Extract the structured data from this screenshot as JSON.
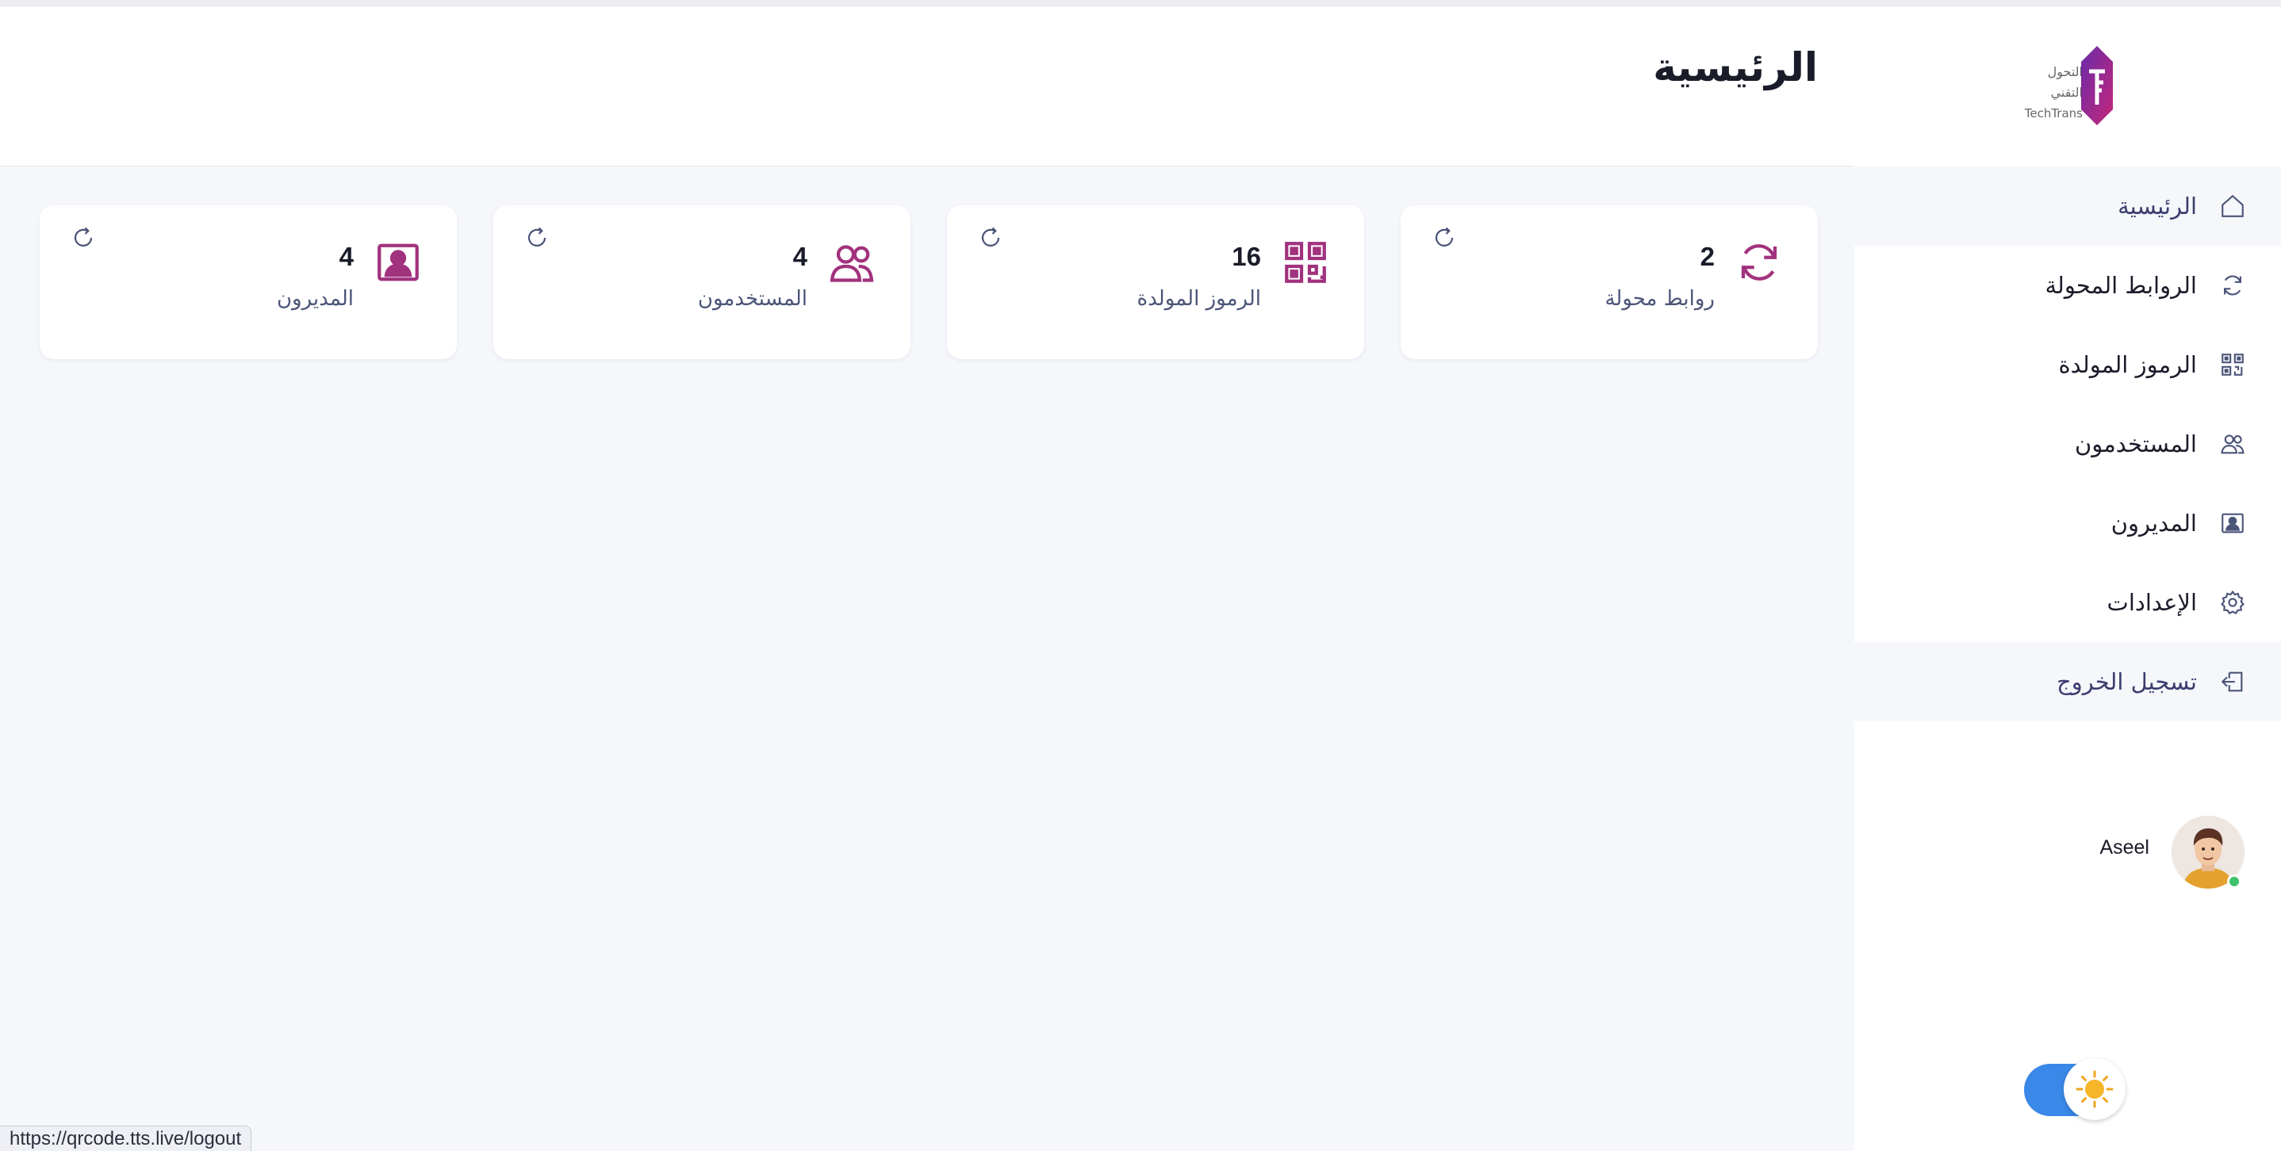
{
  "header": {
    "title": "الرئيسية"
  },
  "logo": {
    "text_ar": "التحول التقني",
    "text_en": "TechTrans"
  },
  "sidebar": {
    "items": [
      {
        "label": "الرئيسية",
        "icon": "home-icon",
        "active": true
      },
      {
        "label": "الروابط المحولة",
        "icon": "sync-icon"
      },
      {
        "label": "الرموز المولدة",
        "icon": "qr-code-icon"
      },
      {
        "label": "المستخدمون",
        "icon": "users-icon"
      },
      {
        "label": "المديرون",
        "icon": "admin-icon"
      },
      {
        "label": "الإعدادات",
        "icon": "gear-icon"
      }
    ],
    "logout": {
      "label": "تسجيل الخروج",
      "icon": "logout-icon"
    }
  },
  "profile": {
    "name": "Aseel",
    "status": "online"
  },
  "theme_toggle": {
    "mode": "light",
    "icon": "sun-icon"
  },
  "stats": [
    {
      "value": "2",
      "label": "روابط محولة",
      "icon": "sync-icon"
    },
    {
      "value": "16",
      "label": "الرموز المولدة",
      "icon": "qr-code-icon"
    },
    {
      "value": "4",
      "label": "المستخدمون",
      "icon": "users-icon"
    },
    {
      "value": "4",
      "label": "المديرون",
      "icon": "admin-icon"
    }
  ],
  "status_bar": {
    "url": "https://qrcode.tts.live/logout"
  },
  "colors": {
    "accent": "#a1327e",
    "nav_active": "#3b3d6e",
    "toggle": "#3a88e8",
    "online": "#3fc26c"
  }
}
